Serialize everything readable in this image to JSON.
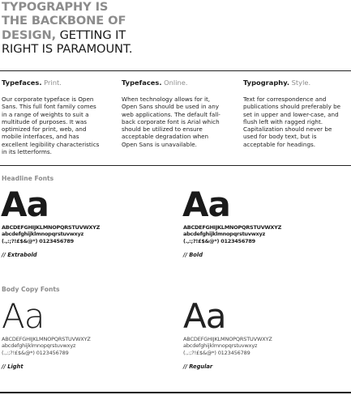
{
  "hero": {
    "line1": "TYPOGRAPHY IS",
    "line2": "THE BACKBONE OF",
    "line3_bold": "DESIGN,",
    "line3_light": " GETTING IT",
    "line4": "RIGHT IS PARAMOUNT."
  },
  "columns": [
    {
      "title": "Typefaces.",
      "subtitle": " Print.",
      "body": "Our corporate typeface is Open Sans. This full font family comes in a range of weights to suit a multitude of purposes. It was optimized for print, web, and mobile interfaces, and has excellent legibility characteristics in its letterforms."
    },
    {
      "title": "Typefaces.",
      "subtitle": " Online.",
      "body": "When technology allows for it, Open Sans should be used in any web applications. The default fall-back corporate font is Arial which should be utilized to ensure acceptable degradation when Open Sans is unavailable."
    },
    {
      "title": "Typography.",
      "subtitle": " Style.",
      "body": "Text for correspondence and publications should preferably be set in upper and lower-case, and flush left with ragged right. Capitalization should never be used for body text, but is acceptable for headings."
    }
  ],
  "headline_fonts": {
    "label": "Headline Fonts",
    "specimens": [
      {
        "sample": "Aa",
        "upper": "ABCDEFGHIJKLMNOPQRSTUVWXYZ",
        "lower": "abcdefghijklmnopqrstuvwxyz",
        "symbols": "(.,:;?!£$&@*) 0123456789",
        "caption": "// Extrabold"
      },
      {
        "sample": "Aa",
        "upper": "ABCDEFGHIJKLMNOPQRSTUVWXYZ",
        "lower": "abcdefghijklmnopqrstuvwxyz",
        "symbols": "(.,:;?!£$&@*) 0123456789",
        "caption": "// Bold"
      }
    ]
  },
  "body_fonts": {
    "label": "Body Copy Fonts",
    "specimens": [
      {
        "sample": "Aa",
        "upper": "ABCDEFGHIJKLMNOPQRSTUVWXYZ",
        "lower": "abcdefghijklmnopqrstuvwxyz",
        "symbols": "(.,:;?!£$&@*) 0123456789",
        "caption": "// Light"
      },
      {
        "sample": "Aa",
        "upper": "ABCDEFGHIJKLMNOPQRSTUVWXYZ",
        "lower": "abcdefghijklmnopqrstuvwxyz",
        "symbols": "(.,:;?!£$&@*) 0123456789",
        "caption": "// Regular"
      }
    ]
  }
}
